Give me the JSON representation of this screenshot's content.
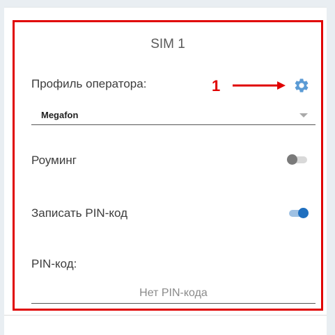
{
  "sim": {
    "title": "SIM 1"
  },
  "operator_profile": {
    "label": "Профиль оператора:",
    "selected": "Megafon",
    "settings_icon": "gear-icon",
    "settings_icon_color": "#5b9bd5"
  },
  "roaming": {
    "label": "Роуминг",
    "enabled": false
  },
  "save_pin": {
    "label": "Записать PIN-код",
    "enabled": true
  },
  "pin": {
    "label": "PIN-код:",
    "placeholder": "Нет PIN-кода"
  },
  "annotation": {
    "number": "1",
    "color": "#e00000"
  },
  "colors": {
    "highlight": "#e00000",
    "toggle_on": "#1f6fbf",
    "toggle_off": "#7a7a7a"
  }
}
